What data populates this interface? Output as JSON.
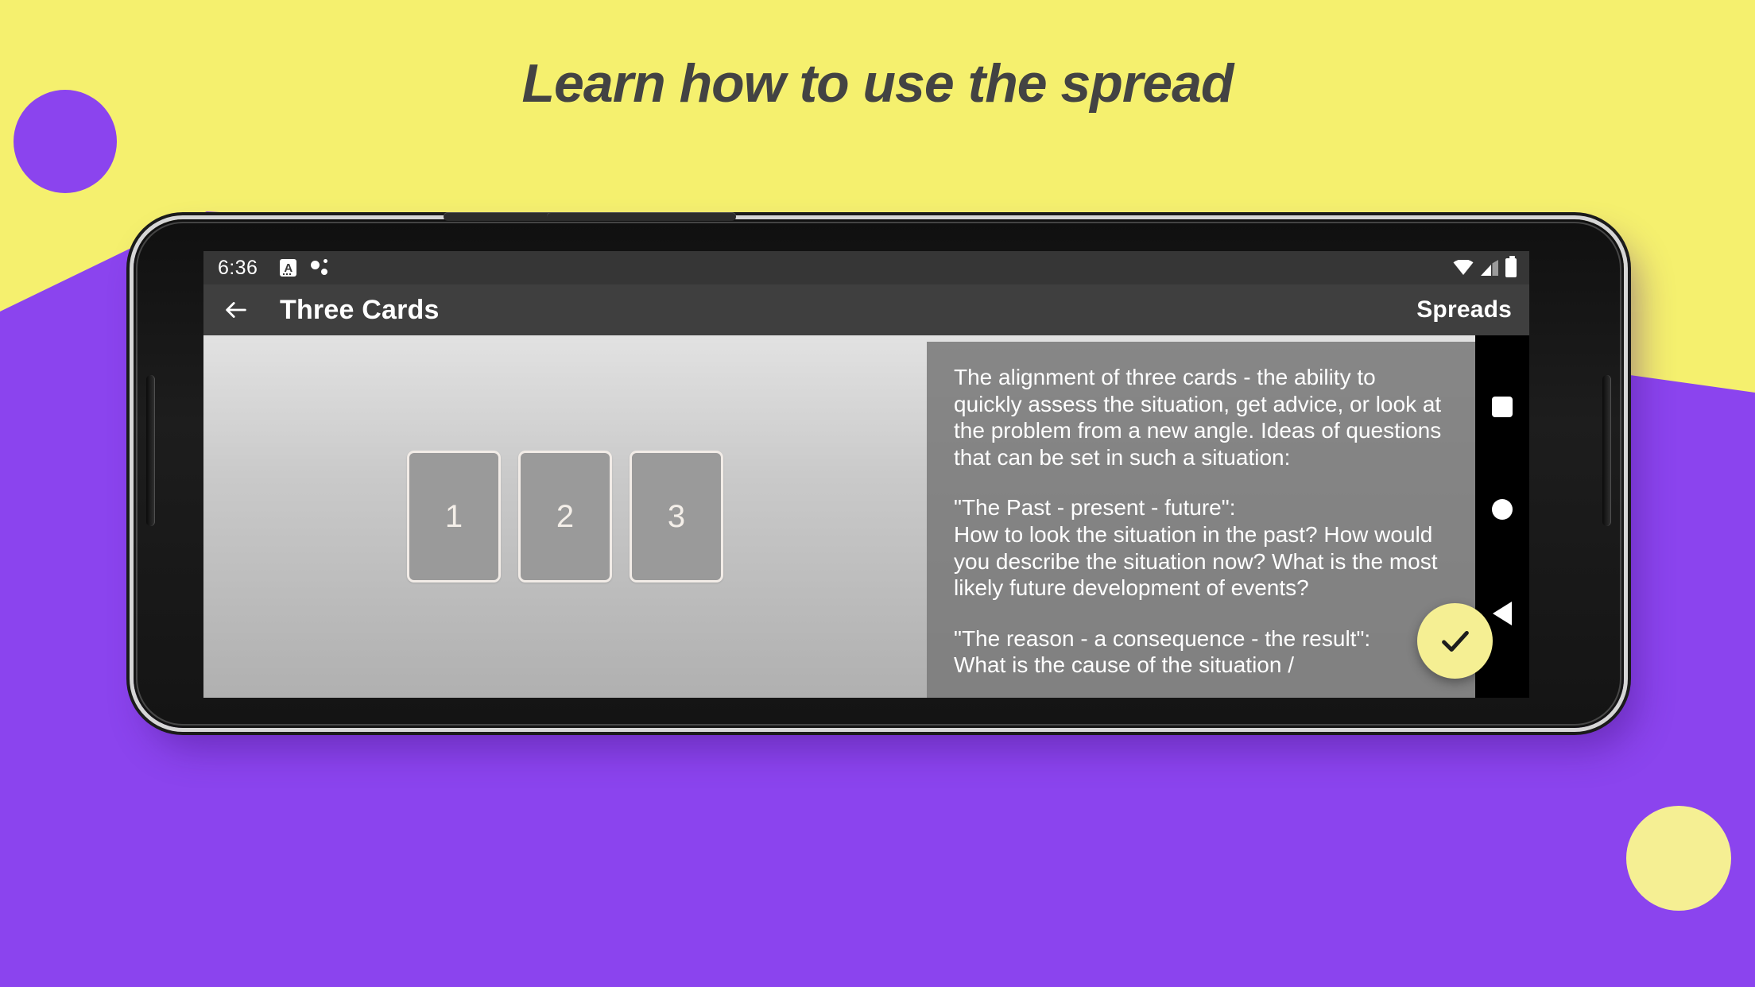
{
  "headline": "Learn how to use the spread",
  "colors": {
    "background_yellow": "#F5F06E",
    "accent_purple": "#8B44EE",
    "fab_yellow": "#F5EF93",
    "appbar_gray": "#3F3F3F",
    "statusbar_gray": "#363636",
    "headline_text": "#434343"
  },
  "phone": {
    "status_bar": {
      "time": "6:36",
      "left_icons": [
        "input-method-a-icon",
        "dots-icon"
      ],
      "right_icons": [
        "wifi-icon",
        "signal-icon",
        "battery-icon"
      ]
    },
    "app_bar": {
      "back_icon": "arrow-left-icon",
      "title": "Three Cards",
      "action_label": "Spreads"
    },
    "spread": {
      "cards": [
        {
          "label": "1"
        },
        {
          "label": "2"
        },
        {
          "label": "3"
        }
      ]
    },
    "description": {
      "paragraphs": [
        "The alignment of three cards - the ability to quickly assess the situation, get advice, or look at the problem from a new angle. Ideas of questions that can be set in such a situation:",
        "  \"The Past - present - future\":\n  How to look the situation in the past? How would you describe the situation now? What is the most likely future development of events?",
        "  \"The reason - a consequence - the result\":\n  What is the cause of the situation /"
      ]
    },
    "fab": {
      "icon": "check-icon"
    },
    "nav_bar": {
      "buttons": [
        {
          "icon": "square-recent-apps-icon"
        },
        {
          "icon": "circle-home-icon"
        },
        {
          "icon": "triangle-back-icon"
        }
      ]
    }
  }
}
